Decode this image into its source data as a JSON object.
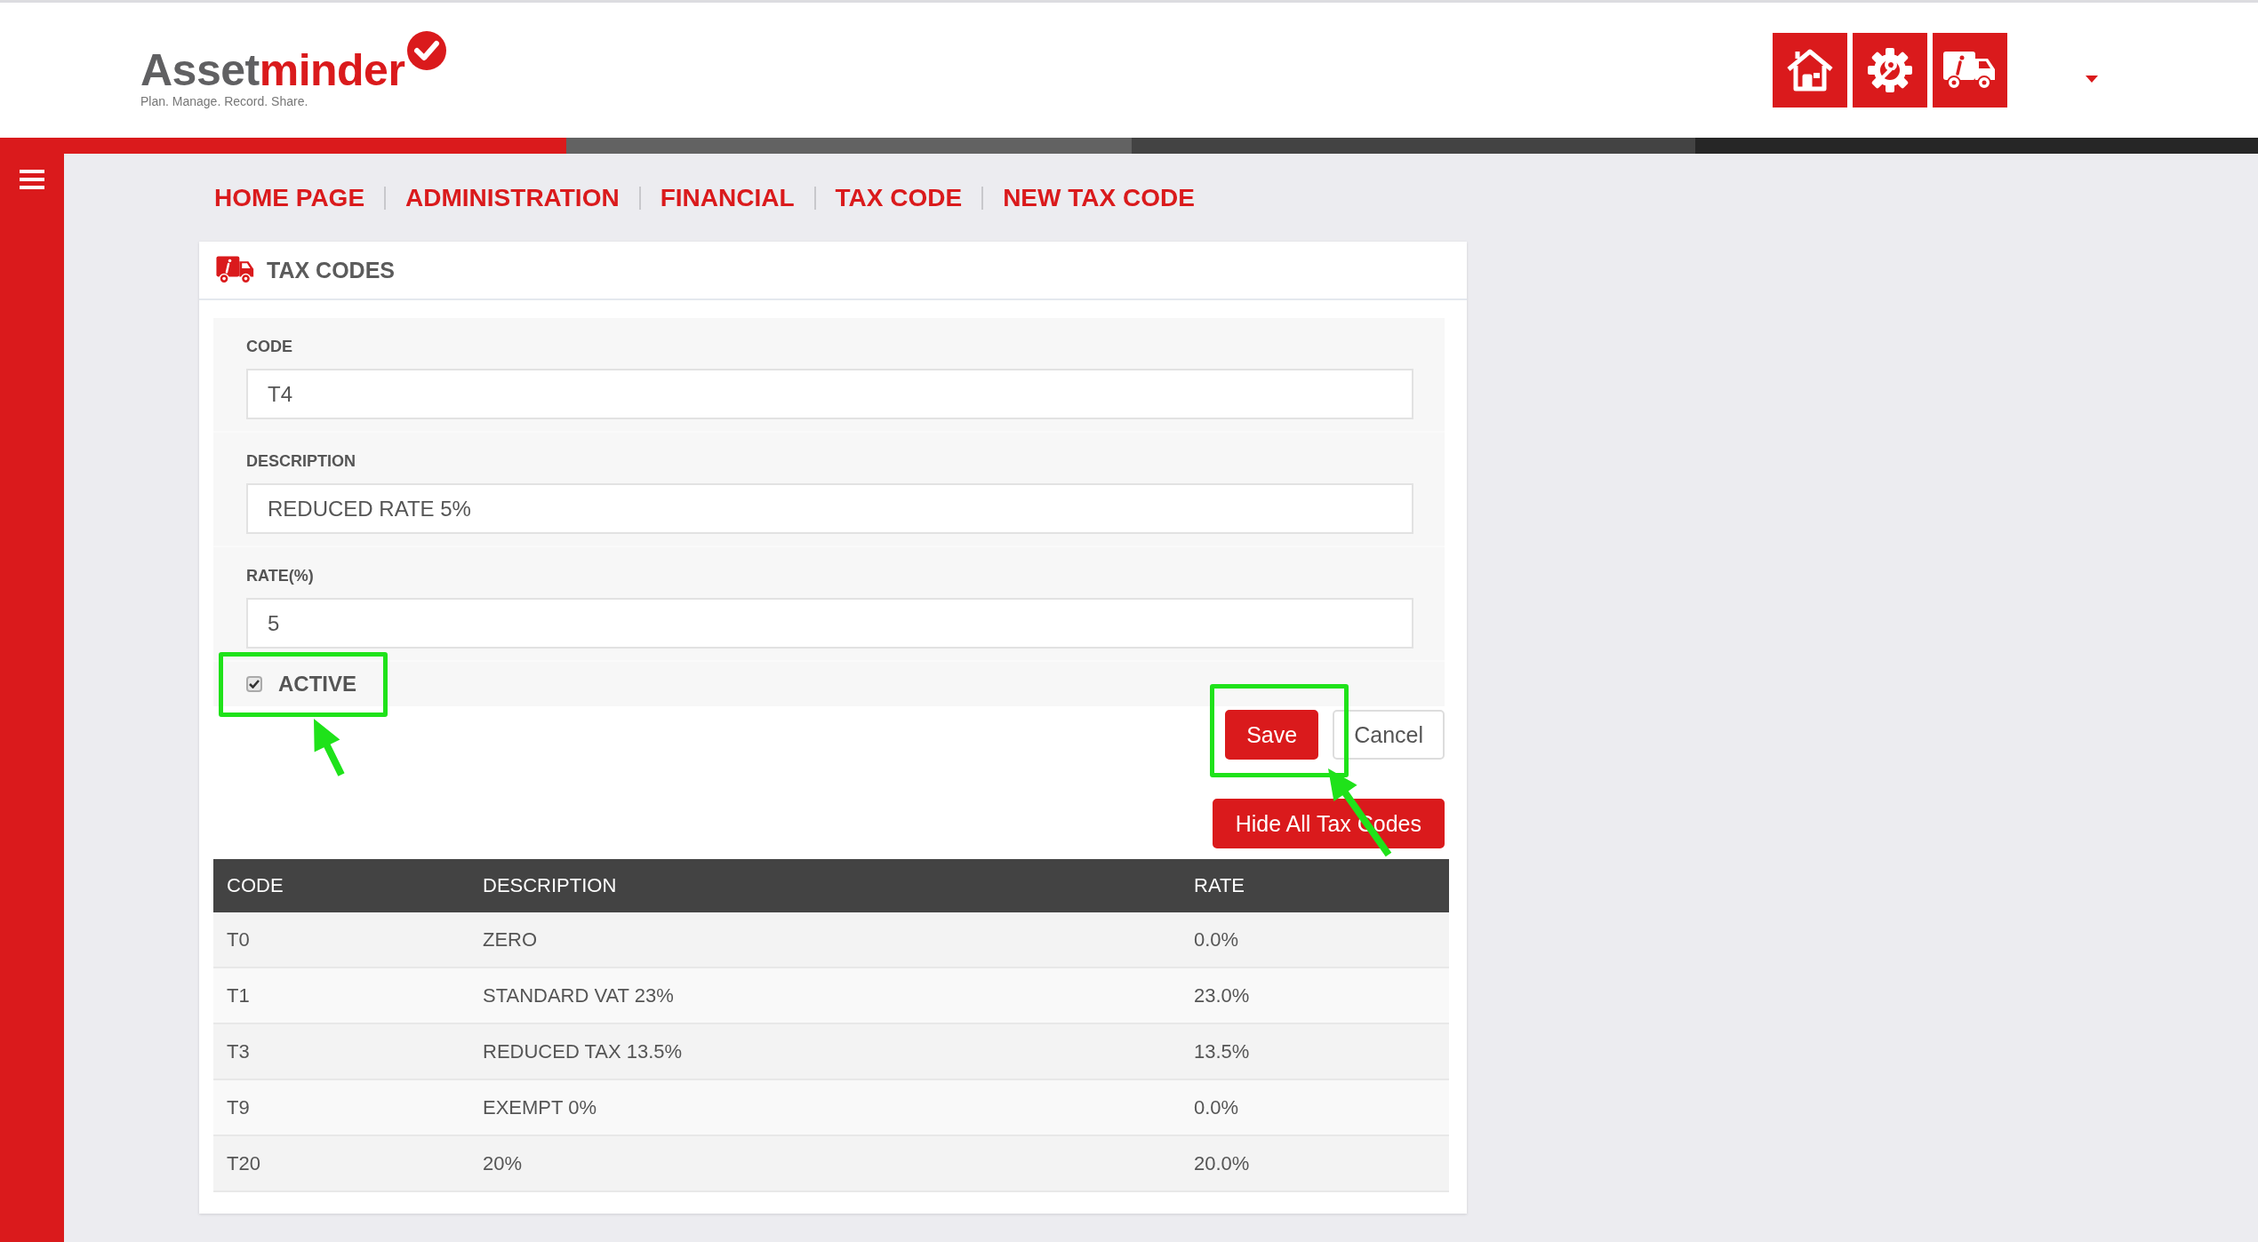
{
  "logo": {
    "brand_first": "Asset",
    "brand_second": "minder",
    "tagline": "Plan. Manage. Record. Share."
  },
  "breadcrumb": [
    "HOME PAGE",
    "ADMINISTRATION",
    "FINANCIAL",
    "TAX CODE",
    "NEW TAX CODE"
  ],
  "card": {
    "title": "TAX CODES"
  },
  "form": {
    "fields": [
      {
        "label": "CODE",
        "value": "T4"
      },
      {
        "label": "DESCRIPTION",
        "value": "REDUCED RATE 5%"
      },
      {
        "label": "RATE(%)",
        "value": "5"
      }
    ],
    "active": {
      "label": "ACTIVE",
      "checked": true
    }
  },
  "buttons": [
    {
      "label": "Save",
      "kind": "primary"
    },
    {
      "label": "Cancel",
      "kind": "secondary"
    }
  ],
  "toggle_button": "Hide All Tax Codes",
  "table": {
    "columns": [
      "CODE",
      "DESCRIPTION",
      "RATE"
    ],
    "rows": [
      [
        "T0",
        "ZERO",
        "0.0%"
      ],
      [
        "T1",
        "STANDARD VAT 23%",
        "23.0%"
      ],
      [
        "T3",
        "REDUCED TAX 13.5%",
        "13.5%"
      ],
      [
        "T9",
        "EXEMPT 0%",
        "0.0%"
      ],
      [
        "T20",
        "20%",
        "20.0%"
      ]
    ]
  }
}
